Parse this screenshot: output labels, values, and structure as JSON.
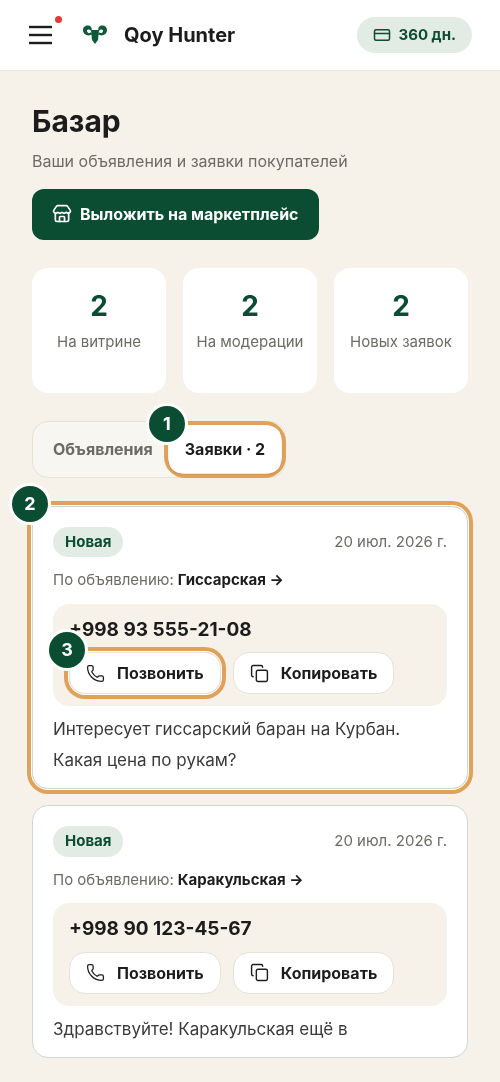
{
  "header": {
    "menu_notification": true,
    "brand": "Qoy Hunter",
    "days_badge": "360 дн."
  },
  "page": {
    "title": "Базар",
    "subtitle": "Ваши объявления и заявки покупателей",
    "primary_button": "Выложить на маркетплейс"
  },
  "stats": [
    {
      "value": "2",
      "label": "На витрине"
    },
    {
      "value": "2",
      "label": "На модерации"
    },
    {
      "value": "2",
      "label": "Новых заявок"
    }
  ],
  "tabs": [
    {
      "label": "Объявления",
      "selected": false
    },
    {
      "label": "Заявки · 2",
      "selected": true,
      "marker": "1"
    }
  ],
  "requests": [
    {
      "status": "Новая",
      "date": "20 июл. 2026 г.",
      "listing_prefix": "По объявлению:",
      "listing": "Гиссарская →",
      "phone": "+998 93 555-21-08",
      "call_button": "Позвонить",
      "copy_button": "Копировать",
      "message": "Интересует гиссарский баран на Курбан. Какая цена по рукам?",
      "marker": "2",
      "call_marker": "3"
    },
    {
      "status": "Новая",
      "date": "20 июл. 2026 г.",
      "listing_prefix": "По объявлению:",
      "listing": "Каракульская →",
      "phone": "+998 90 123-45-67",
      "call_button": "Позвонить",
      "copy_button": "Копировать",
      "message": "Здравствуйте! Каракульская ещё в"
    }
  ]
}
